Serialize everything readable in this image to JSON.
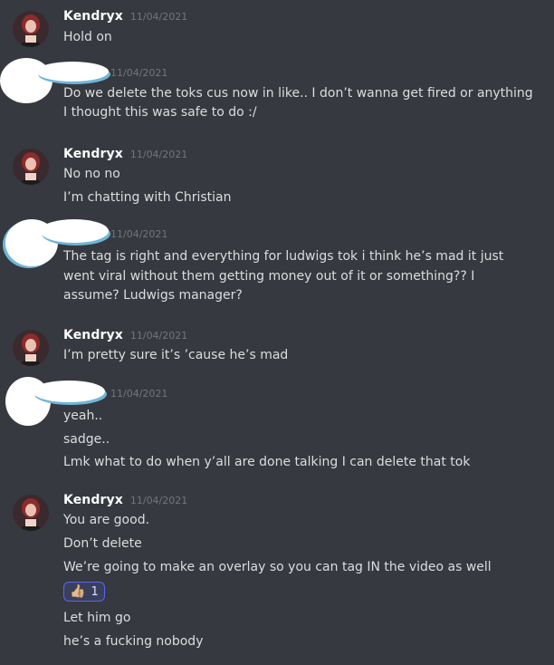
{
  "messages": [
    {
      "author": "Kendryx",
      "time": "11/04/2021",
      "lines": [
        "Hold on"
      ]
    },
    {
      "author": "",
      "time": "11/04/2021",
      "lines": [
        "Do we delete the toks cus now in like.. I don’t wanna get fired or anything I thought this was safe to do :/"
      ]
    },
    {
      "author": "Kendryx",
      "time": "11/04/2021",
      "lines": [
        "No no no",
        "I’m chatting with Christian"
      ]
    },
    {
      "author": "",
      "time": "11/04/2021",
      "lines": [
        "The tag is right and everything for ludwigs tok i think he’s mad it just went viral without them getting money out of it or something?? I assume? Ludwigs manager?"
      ]
    },
    {
      "author": "Kendryx",
      "time": "11/04/2021",
      "lines": [
        "I’m pretty sure it’s ’cause he’s mad"
      ]
    },
    {
      "author": "",
      "time": "11/04/2021",
      "lines": [
        "yeah..",
        "sadge..",
        "Lmk what to do when y’all are done talking I can delete that tok"
      ]
    },
    {
      "author": "Kendryx",
      "time": "11/04/2021",
      "lines": [
        "You are good.",
        "Don’t delete",
        "We’re going to make an overlay so you can tag IN the video as well",
        "Let him go",
        "he’s a fucking nobody"
      ],
      "reaction": {
        "emoji": "👍🏼",
        "count": "1"
      }
    }
  ]
}
